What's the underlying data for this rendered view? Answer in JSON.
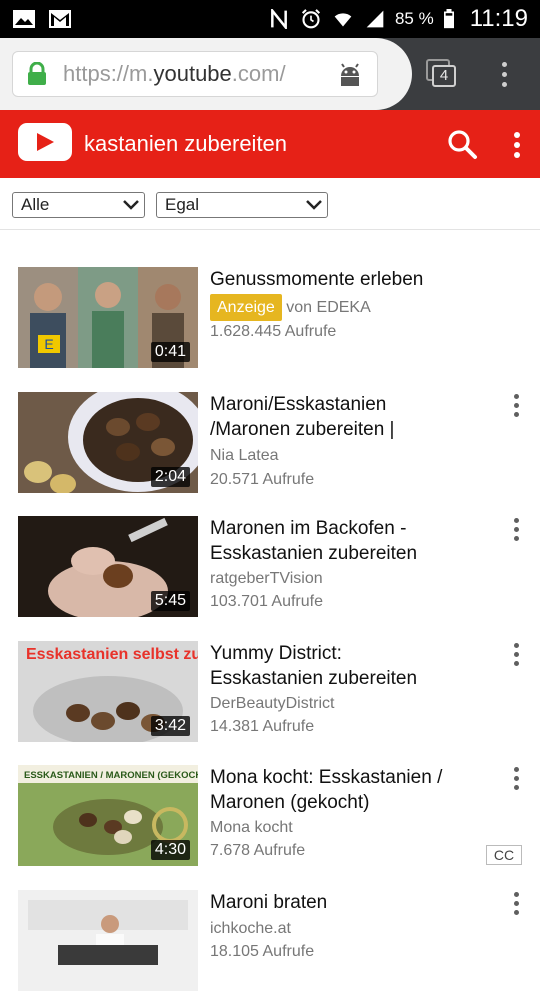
{
  "status_bar": {
    "battery_pct": "85 %",
    "time": "11:19"
  },
  "browser": {
    "url_scheme": "https://m.",
    "url_domain": "youtube",
    "url_rest": ".com/",
    "tab_count": "4"
  },
  "header": {
    "query": "kastanien zubereiten"
  },
  "filters": {
    "type": "Alle",
    "duration": "Egal"
  },
  "videos": [
    {
      "title": "Genussmomente erleben",
      "ad_label": "Anzeige",
      "channel": "von EDEKA",
      "views": "1.628.445 Aufrufe",
      "duration": "0:41"
    },
    {
      "title": "Maroni/Esskastanien /Maronen zubereiten |",
      "channel": "Nia Latea",
      "views": "20.571 Aufrufe",
      "duration": "2:04"
    },
    {
      "title": "Maronen im Backofen - Esskastanien zubereiten",
      "channel": "ratgeberTVision",
      "views": "103.701 Aufrufe",
      "duration": "5:45"
    },
    {
      "title": "Yummy District: Esskastanien zubereiten",
      "channel": "DerBeautyDistrict",
      "views": "14.381 Aufrufe",
      "duration": "3:42",
      "thumb_text": "Esskastanien selbst zubereiten"
    },
    {
      "title": "Mona kocht: Esskastanien / Maronen (gekocht)",
      "channel": "Mona kocht",
      "views": "7.678 Aufrufe",
      "duration": "4:30",
      "thumb_text": "ESSKASTANIEN / MARONEN (GEKOCHT)",
      "cc": "CC"
    },
    {
      "title": "Maroni braten",
      "channel": "ichkoche.at",
      "views": "18.105 Aufrufe"
    }
  ],
  "colors": {
    "yt_red": "#e62117",
    "ad_yellow": "#e6b620"
  }
}
